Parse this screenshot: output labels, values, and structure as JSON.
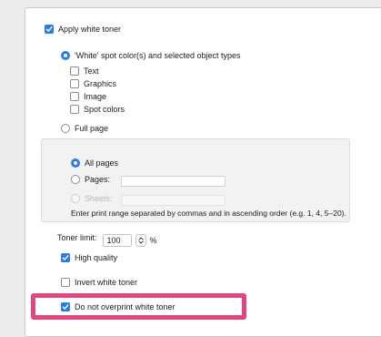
{
  "apply_white_toner": {
    "label": "Apply white toner",
    "checked": true
  },
  "spot_color_option": {
    "label": "'White' spot color(s) and selected object types",
    "selected": true
  },
  "object_types": [
    {
      "label": "Text",
      "checked": false
    },
    {
      "label": "Graphics",
      "checked": false
    },
    {
      "label": "Image",
      "checked": false
    },
    {
      "label": "Spot colors",
      "checked": false
    }
  ],
  "full_page_option": {
    "label": "Full page",
    "selected": false
  },
  "page_range": {
    "all_pages_label": "All pages",
    "pages_label": "Pages:",
    "sheets_label": "Sheets:",
    "hint": "Enter print range separated by commas and in ascending order (e.g. 1, 4, 5–20)."
  },
  "toner_limit": {
    "label": "Toner limit:",
    "value": "100",
    "unit": "%"
  },
  "high_quality": {
    "label": "High quality",
    "checked": true
  },
  "invert_white_toner": {
    "label": "Invert white toner",
    "checked": false
  },
  "do_not_overprint": {
    "label": "Do not overprint white toner",
    "checked": true
  },
  "colors": {
    "accent": "#2a7be6",
    "highlight": "#e0457f"
  }
}
